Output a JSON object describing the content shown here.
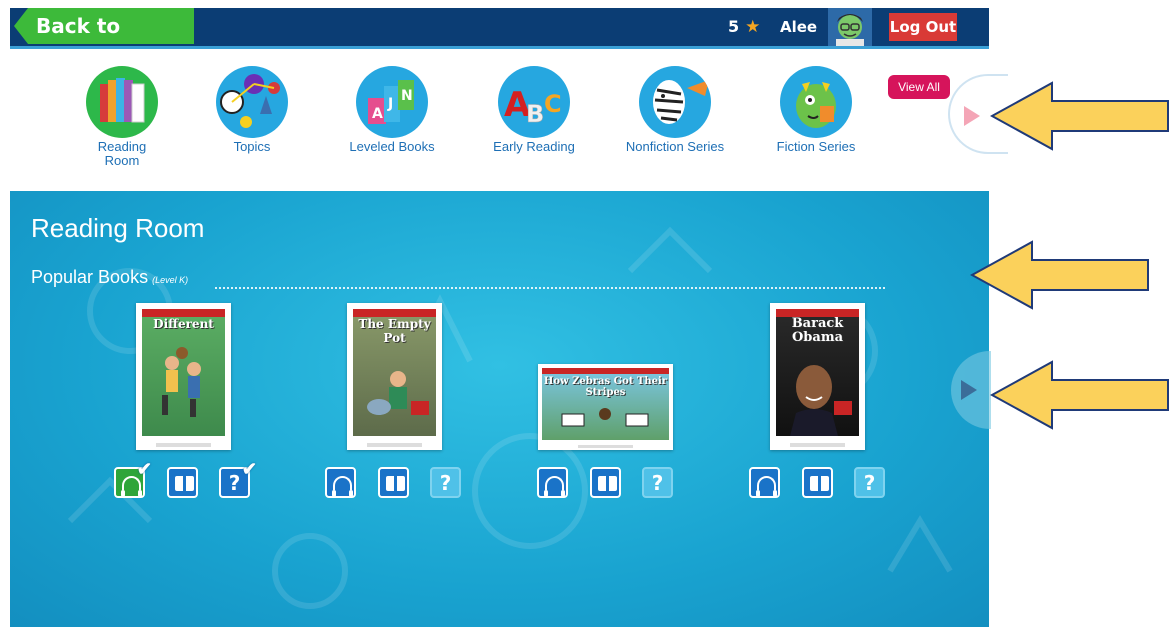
{
  "header": {
    "back_label": "Back to Reading",
    "stars_count": "5",
    "username": "Alee",
    "logout_label": "Log Out"
  },
  "categories": [
    {
      "label": "Reading\nRoom",
      "icon": "reading-room-icon"
    },
    {
      "label": "Topics",
      "icon": "topics-icon"
    },
    {
      "label": "Leveled Books",
      "icon": "leveled-books-icon"
    },
    {
      "label": "Early Reading",
      "icon": "early-reading-icon"
    },
    {
      "label": "Nonfiction Series",
      "icon": "nonfiction-series-icon"
    },
    {
      "label": "Fiction Series",
      "icon": "fiction-series-icon"
    }
  ],
  "panel": {
    "title": "Reading Room",
    "section_title": "Popular Books",
    "level": "(Level K)",
    "view_all": "View All"
  },
  "books": [
    {
      "title": "Different",
      "listen_done": true,
      "read_done": false,
      "quiz_done": true,
      "quiz_enabled": true
    },
    {
      "title": "The Empty Pot",
      "listen_done": false,
      "read_done": false,
      "quiz_done": false,
      "quiz_enabled": false
    },
    {
      "title": "How Zebras Got Their Stripes",
      "listen_done": false,
      "read_done": false,
      "quiz_done": false,
      "quiz_enabled": false
    },
    {
      "title": "Barack Obama",
      "listen_done": false,
      "read_done": false,
      "quiz_done": false,
      "quiz_enabled": false
    }
  ],
  "colors": {
    "topbar": "#0b3d74",
    "back_button": "#3dba3a",
    "logout": "#d93a36",
    "panel": "#19a3d0",
    "view_all": "#d6145b",
    "annotation_arrow": "#fbd15b"
  }
}
